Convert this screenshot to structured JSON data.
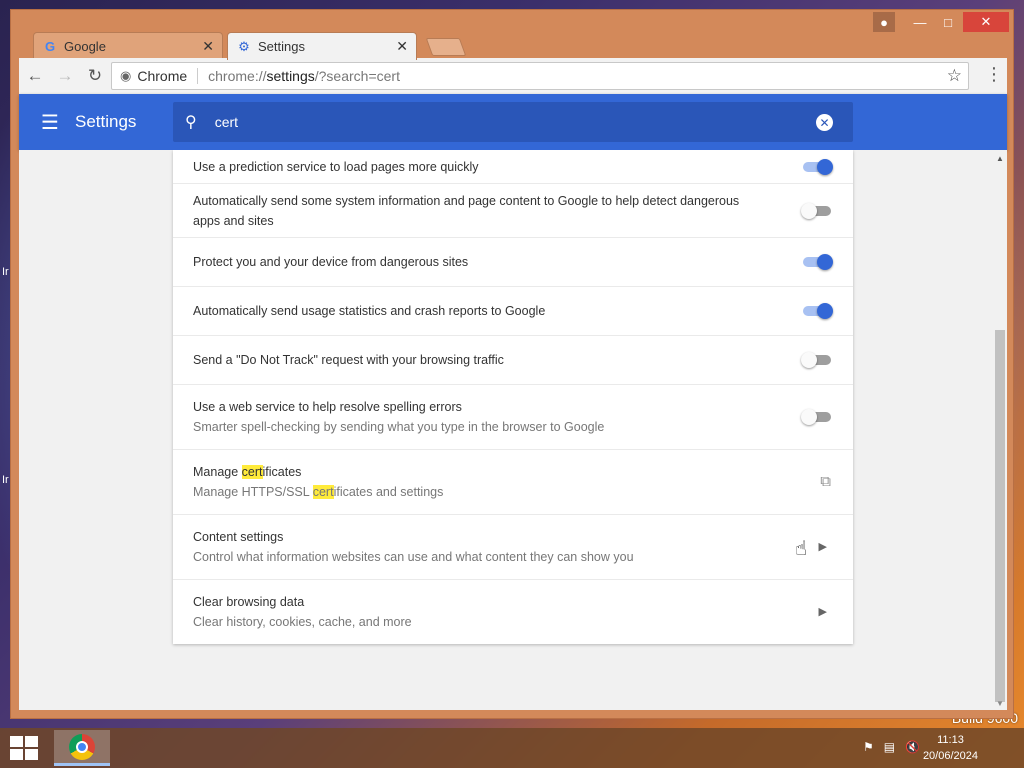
{
  "desktop": {
    "left_labels": [
      "Ir",
      "Ir"
    ],
    "watermark": "Build 9600"
  },
  "window": {
    "tabs": [
      {
        "title": "Google",
        "icon": "google-g-icon"
      },
      {
        "title": "Settings",
        "icon": "gear-icon"
      }
    ]
  },
  "toolbar": {
    "omnibox_label": "Chrome",
    "url_prefix": "chrome://",
    "url_host": "settings",
    "url_suffix": "/?search=cert"
  },
  "settings": {
    "title": "Settings",
    "search_query": "cert"
  },
  "rows": [
    {
      "primary": "Use a prediction service to load pages more quickly",
      "control": "toggle",
      "on": true
    },
    {
      "primary": "Automatically send some system information and page content to Google to help detect dangerous apps and sites",
      "control": "toggle",
      "on": false
    },
    {
      "primary": "Protect you and your device from dangerous sites",
      "control": "toggle",
      "on": true
    },
    {
      "primary": "Automatically send usage statistics and crash reports to Google",
      "control": "toggle",
      "on": true
    },
    {
      "primary": "Send a \"Do Not Track\" request with your browsing traffic",
      "control": "toggle",
      "on": false
    },
    {
      "primary": "Use a web service to help resolve spelling errors",
      "secondary": "Smarter spell-checking by sending what you type in the browser to Google",
      "control": "toggle",
      "on": false
    },
    {
      "primary_pre": "Manage ",
      "primary_hl": "cert",
      "primary_post": "ificates",
      "secondary_pre": "Manage HTTPS/SSL ",
      "secondary_hl": "cert",
      "secondary_post": "ificates and settings",
      "control": "external-link"
    },
    {
      "primary": "Content settings",
      "secondary": "Control what information websites can use and what content they can show you",
      "control": "chevron"
    },
    {
      "primary": "Clear browsing data",
      "secondary": "Clear history, cookies, cache, and more",
      "control": "chevron"
    }
  ],
  "taskbar": {
    "time": "11:13",
    "date": "20/06/2024"
  },
  "colors": {
    "accent": "#3367d6",
    "highlight": "#ffeb3b"
  }
}
